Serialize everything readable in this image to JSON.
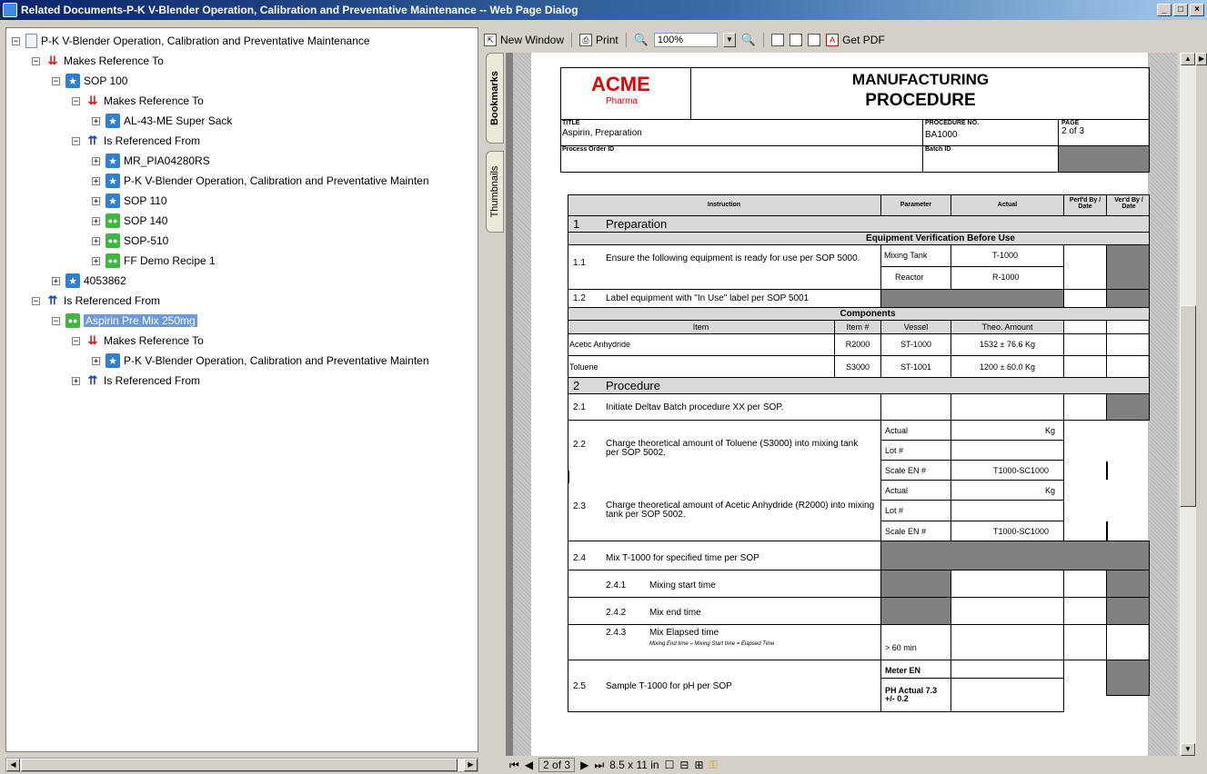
{
  "window": {
    "title": "Related Documents-P-K V-Blender Operation, Calibration and Preventative Maintenance -- Web Page Dialog",
    "minimize": "_",
    "maximize": "□",
    "close": "×"
  },
  "tree": {
    "root": "P-K V-Blender Operation, Calibration and Preventative Maintenance",
    "n1": "Makes Reference To",
    "n2": "SOP 100",
    "n3": "Makes Reference To",
    "n4": "AL-43-ME Super Sack",
    "n5": "Is Referenced From",
    "n6": "MR_PIA04280RS",
    "n7": "P-K V-Blender Operation, Calibration and Preventative Mainten",
    "n8": "SOP 110",
    "n9": "SOP 140",
    "n10": "SOP-510",
    "n11": "FF Demo Recipe 1",
    "n12": "4053862",
    "n13": "Is Referenced From",
    "n14": "Aspirin Pre Mix 250mg",
    "n15": "Makes Reference To",
    "n16": "P-K V-Blender Operation, Calibration and Preventative Mainten",
    "n17": "Is Referenced From"
  },
  "toolbar": {
    "new_window": "New Window",
    "print": "Print",
    "zoom": "100%",
    "get_pdf": "Get PDF"
  },
  "sidetabs": {
    "bookmarks": "Bookmarks",
    "thumbnails": "Thumbnails"
  },
  "status": {
    "page": "2 of 3",
    "size": "8.5 x 11 in"
  },
  "doc": {
    "logo": "ACME",
    "logo_sub": "Pharma",
    "heading1": "MANUFACTURING",
    "heading2": "PROCEDURE",
    "title_label": "TITLE",
    "title": "Aspirin, Preparation",
    "proc_label": "PROCEDURE NO.",
    "proc": "BA1000",
    "page_label": "PAGE",
    "page": "2  of  3",
    "order_label": "Process Order ID",
    "batch_label": "Batch ID",
    "h_instruction": "Instruction",
    "h_parameter": "Parameter",
    "h_actual": "Actual",
    "h_perf": "Perf'd By / Date",
    "h_ver": "Ver'd By / Date",
    "s1_num": "1",
    "s1": "Preparation",
    "equip": "Equipment Verification Before Use",
    "r11_num": "1.1",
    "r11": "Ensure the following equipment is ready for use per SOP 5000.",
    "mixing_tank": "Mixing Tank",
    "t1000": "T-1000",
    "reactor": "Reactor",
    "r1000": "R-1000",
    "r12_num": "1.2",
    "r12": "Label equipment with \"In Use\" label per SOP 5001",
    "components": "Components",
    "c_item": "Item",
    "c_itemno": "Item #",
    "c_vessel": "Vessel",
    "c_amount": "Theo. Amount",
    "c1_item": "Acetic Anhydride",
    "c1_no": "R2000",
    "c1_vessel": "ST-1000",
    "c1_amount": "1532 ± 76.6 Kg",
    "c2_item": "Toluene",
    "c2_no": "S3000",
    "c2_vessel": "ST-1001",
    "c2_amount": "1200 ± 60.0 Kg",
    "s2_num": "2",
    "s2": "Procedure",
    "r21_num": "2.1",
    "r21": "Initiate Deltav Batch procedure XX  per SOP.",
    "r22_num": "2.2",
    "r22": "Charge theoretical amount of Toluene (S3000) into mixing tank per SOP 5002.",
    "actual": "Actual",
    "kg": "Kg",
    "lot": "Lot #",
    "scale": "Scale EN #",
    "scale_val": "T1000-SC1000",
    "r23_num": "2.3",
    "r23": "Charge theoretical amount of Acetic Anhydride (R2000) into mixing tank per SOP 5002.",
    "r24_num": "2.4",
    "r24": "Mix T-1000 for specified time per SOP",
    "r241_num": "2.4.1",
    "r241": "Mixing start time",
    "r242_num": "2.4.2",
    "r242": "Mix end time",
    "r243_num": "2.4.3",
    "r243": "Mix Elapsed time",
    "r243_note": "Mixing End time – Mixing Start time = Elapsed Time",
    "gt60": "> 60 min",
    "r25_num": "2.5",
    "r25": "Sample T-1000 for pH per SOP",
    "meter": "Meter EN",
    "ph": "PH Actual 7.3 +/- 0.2"
  }
}
